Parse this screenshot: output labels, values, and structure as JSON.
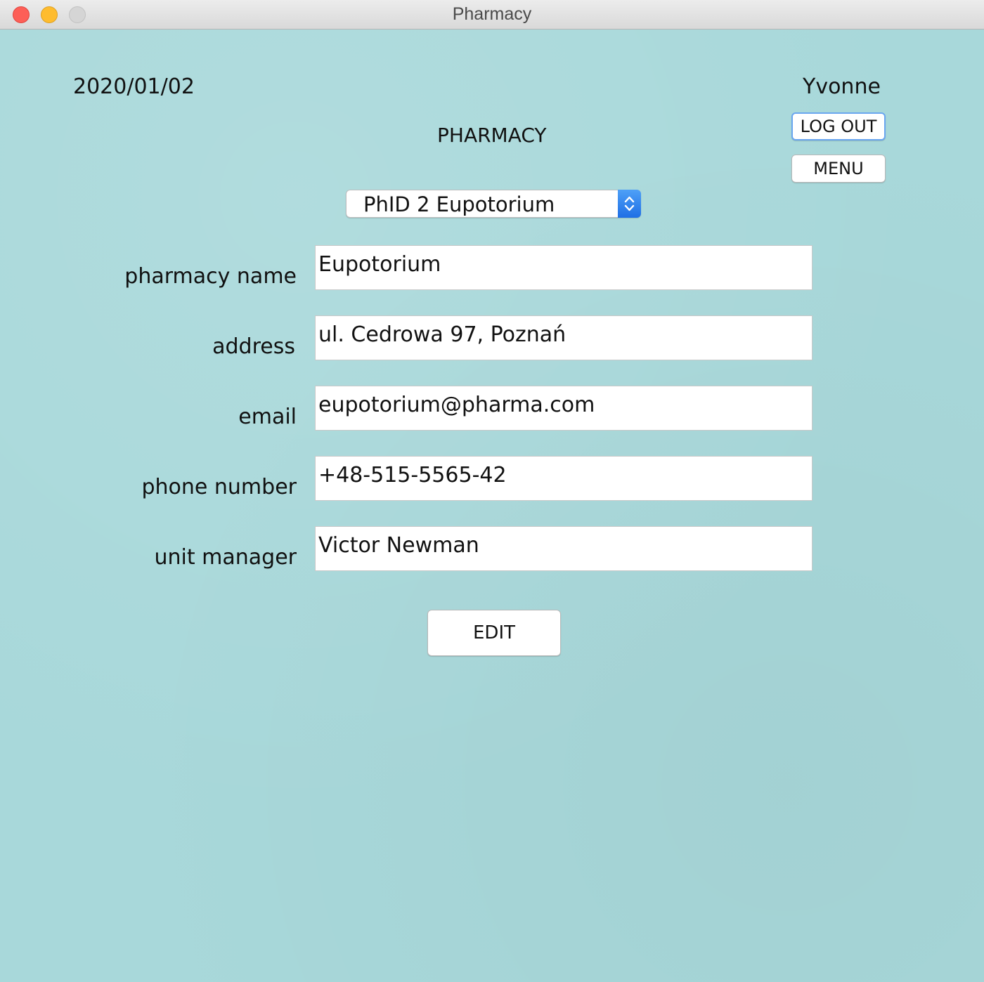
{
  "window": {
    "title": "Pharmacy"
  },
  "header": {
    "date": "2020/01/02",
    "user": "Yvonne",
    "logout_label": "LOG OUT",
    "menu_label": "MENU",
    "heading": "PHARMACY"
  },
  "pharmacy_select": {
    "selected": "PhID 2 Eupotorium"
  },
  "form": {
    "fields": [
      {
        "label": "pharmacy name",
        "value": "Eupotorium"
      },
      {
        "label": "address",
        "value": "ul. Cedrowa 97, Poznań"
      },
      {
        "label": "email",
        "value": "eupotorium@pharma.com"
      },
      {
        "label": "phone number",
        "value": "+48-515-5565-42"
      },
      {
        "label": "unit manager",
        "value": "Victor Newman"
      }
    ],
    "edit_label": "EDIT"
  },
  "colors": {
    "background": "#a8d8da",
    "stepper_accent": "#2f80ed",
    "focus_ring": "#6aa6f0"
  }
}
